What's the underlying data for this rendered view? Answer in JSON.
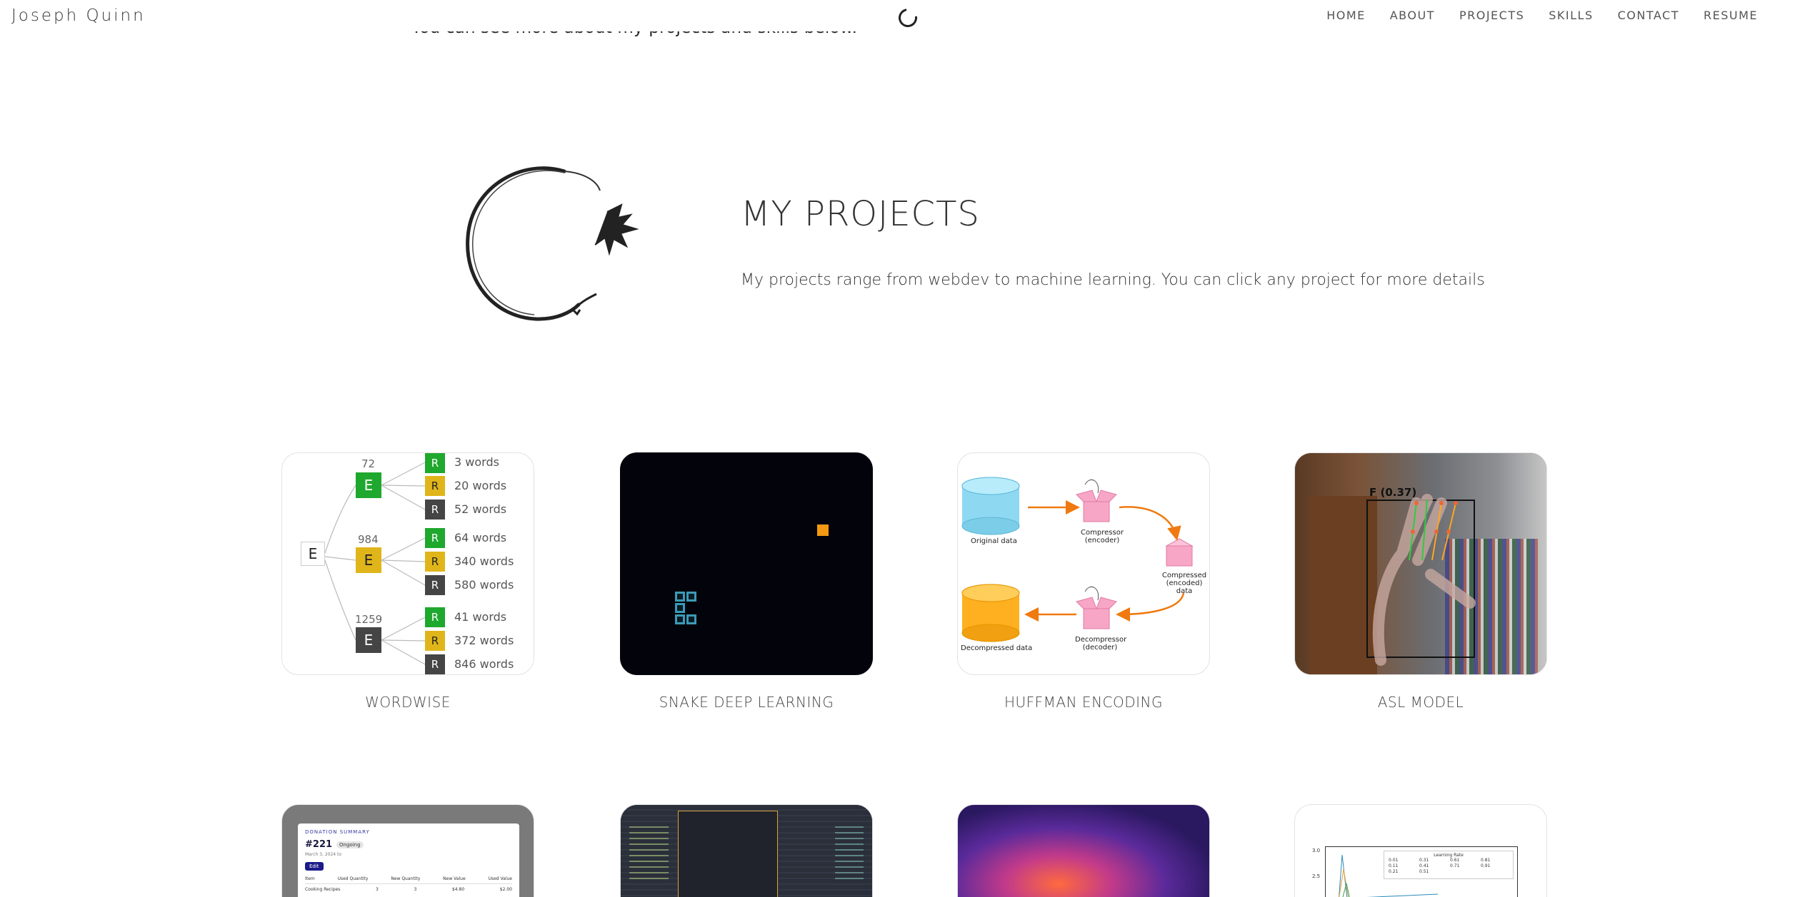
{
  "header": {
    "brand": "Joseph Quinn",
    "nav": [
      "HOME",
      "ABOUT",
      "PROJECTS",
      "SKILLS",
      "CONTACT",
      "RESUME"
    ]
  },
  "intro": {
    "tail_text": "You can see more about my projects and skills below."
  },
  "projects_section": {
    "title": "MY PROJECTS",
    "description": "My projects range from webdev to machine learning. You can click any project for more details"
  },
  "projects": [
    {
      "title": "WORDWISE"
    },
    {
      "title": "SNAKE DEEP LEARNING"
    },
    {
      "title": "HUFFMAN ENCODING"
    },
    {
      "title": "ASL MODEL"
    }
  ],
  "wordwise": {
    "root": "E",
    "branches": [
      {
        "count": "72",
        "letter": "E",
        "color": "green",
        "leaves": [
          {
            "letter": "R",
            "color": "green",
            "text": "3 words"
          },
          {
            "letter": "R",
            "color": "yellow",
            "text": "20 words"
          },
          {
            "letter": "R",
            "color": "grey",
            "text": "52 words"
          }
        ]
      },
      {
        "count": "984",
        "letter": "E",
        "color": "yellow",
        "leaves": [
          {
            "letter": "R",
            "color": "green",
            "text": "64 words"
          },
          {
            "letter": "R",
            "color": "yellow",
            "text": "340 words"
          },
          {
            "letter": "R",
            "color": "grey",
            "text": "580 words"
          }
        ]
      },
      {
        "count": "1259",
        "letter": "E",
        "color": "grey",
        "leaves": [
          {
            "letter": "R",
            "color": "green",
            "text": "41 words"
          },
          {
            "letter": "R",
            "color": "yellow",
            "text": "372 words"
          },
          {
            "letter": "R",
            "color": "grey",
            "text": "846 words"
          }
        ]
      }
    ]
  },
  "huffman": {
    "original": "Original data",
    "compressor": "Compressor",
    "compressor_sub": "(encoder)",
    "compressed": "Compressed",
    "compressed_sub": "(encoded) data",
    "decompressor": "Decompressor",
    "decompressor_sub": "(decoder)",
    "decompressed": "Decompressed data"
  },
  "asl": {
    "label": "F (0.37)"
  },
  "donation": {
    "header": "DONATION SUMMARY",
    "id": "#221",
    "status": "Ongoing",
    "date": "March 3, 2024 to",
    "edit": "Edit",
    "columns": [
      "Item",
      "Used Quantity",
      "New Quantity",
      "New Value",
      "Used Value"
    ],
    "row": [
      "Cooking Recipes",
      "3",
      "3",
      "$4.80",
      "$2.00"
    ]
  },
  "lr_chart": {
    "legend_title": "Learning Rate",
    "legend": [
      "0.01",
      "0.11",
      "0.21",
      "0.31",
      "0.41",
      "0.51",
      "0.61",
      "0.71",
      "0.81",
      "0.91"
    ],
    "ticks": [
      "3.0",
      "2.5"
    ]
  },
  "colors": {
    "green": "#1ea82e",
    "yellow": "#e0b51a",
    "grey": "#454545",
    "food": "#f39a12",
    "snake": "#3a9bb5"
  }
}
